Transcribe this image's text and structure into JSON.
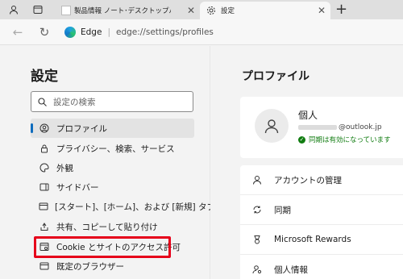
{
  "tabs": {
    "inactive_label": "製品情報 ノート･デスクトップパソコン",
    "active_label": "設定"
  },
  "address": {
    "browser_name": "Edge",
    "url": "edge://settings/profiles"
  },
  "sidebar": {
    "title": "設定",
    "search_placeholder": "設定の検索",
    "items": [
      {
        "label": "プロファイル",
        "icon": "profile-icon"
      },
      {
        "label": "プライバシー、検索、サービス",
        "icon": "lock-icon"
      },
      {
        "label": "外観",
        "icon": "palette-icon"
      },
      {
        "label": "サイドバー",
        "icon": "sidebar-icon"
      },
      {
        "label": "[スタート]、[ホーム]、および [新規] タブ",
        "icon": "home-tab-icon"
      },
      {
        "label": "共有、コピーして貼り付け",
        "icon": "share-icon"
      },
      {
        "label": "Cookie とサイトのアクセス許可",
        "icon": "site-permissions-icon"
      },
      {
        "label": "既定のブラウザー",
        "icon": "browser-icon"
      }
    ]
  },
  "main": {
    "title": "プロファイル",
    "profile": {
      "name": "個人",
      "email_domain": "@outlook.jp",
      "sync_status": "同期は有効になっています"
    },
    "rows": [
      {
        "label": "アカウントの管理",
        "icon": "account-icon"
      },
      {
        "label": "同期",
        "icon": "sync-icon"
      },
      {
        "label": "Microsoft Rewards",
        "icon": "rewards-icon"
      },
      {
        "label": "個人情報",
        "icon": "personal-info-icon"
      }
    ]
  },
  "colors": {
    "accent": "#0f6cbd",
    "highlight_box": "#e6001a",
    "sync_ok": "#107c10"
  }
}
